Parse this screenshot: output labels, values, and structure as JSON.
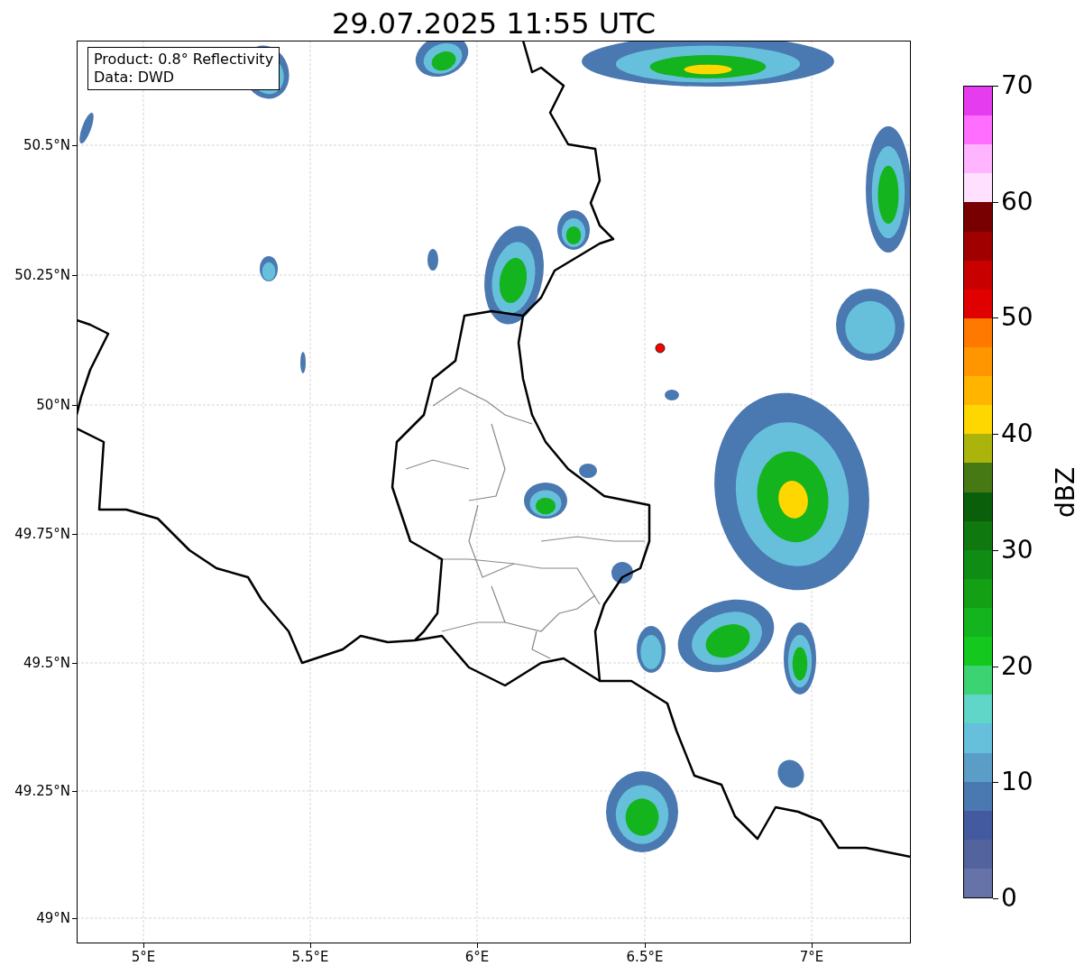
{
  "title": "29.07.2025 11:55 UTC",
  "info_box": {
    "lines": [
      "Product: 0.8° Reflectivity",
      "Data: DWD"
    ]
  },
  "map": {
    "y_tick_labels": [
      "50.5°N",
      "50.25°N",
      "50°N",
      "49.75°N",
      "49.5°N",
      "49.25°N",
      "49°N"
    ],
    "x_tick_labels": [
      "5°E",
      "5.5°E",
      "6°E",
      "6.5°E",
      "7°E"
    ]
  },
  "colorbar": {
    "label": "dBZ",
    "tick_labels": [
      "70",
      "60",
      "50",
      "40",
      "30",
      "20",
      "10",
      "0"
    ],
    "bins": [
      {
        "color": "#e63cf0"
      },
      {
        "color": "#ff6eff"
      },
      {
        "color": "#ffb4ff"
      },
      {
        "color": "#ffe1ff"
      },
      {
        "color": "#780000"
      },
      {
        "color": "#a00000"
      },
      {
        "color": "#c80000"
      },
      {
        "color": "#e10000"
      },
      {
        "color": "#ff7800"
      },
      {
        "color": "#ff9600"
      },
      {
        "color": "#ffb400"
      },
      {
        "color": "#ffd700"
      },
      {
        "color": "#aab40a"
      },
      {
        "color": "#467814"
      },
      {
        "color": "#0a5f0a"
      },
      {
        "color": "#0f780f"
      },
      {
        "color": "#0f8c14"
      },
      {
        "color": "#14a014"
      },
      {
        "color": "#14b41e"
      },
      {
        "color": "#14c81e"
      },
      {
        "color": "#3cd472"
      },
      {
        "color": "#5fd6c8"
      },
      {
        "color": "#66c0dc"
      },
      {
        "color": "#5a9ec8"
      },
      {
        "color": "#4a78b0"
      },
      {
        "color": "#445aa0"
      },
      {
        "color": "#52639e"
      },
      {
        "color": "#6673a8"
      }
    ]
  }
}
